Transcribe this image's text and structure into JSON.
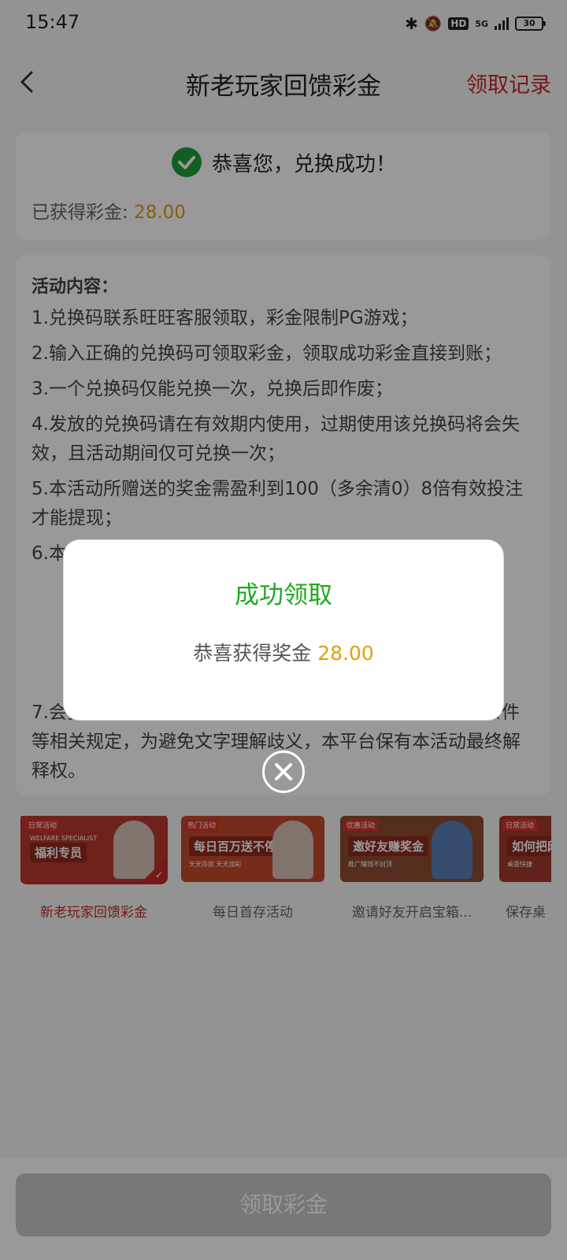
{
  "status_bar": {
    "time": "15:47",
    "hd": "HD",
    "net": "5G",
    "battery": "30"
  },
  "header": {
    "title": "新老玩家回馈彩金",
    "record": "领取记录"
  },
  "success": {
    "message": "恭喜您，兑换成功！",
    "earned_label": "已获得彩金: ",
    "earned_amount": "28.00"
  },
  "activity": {
    "title": "活动内容：",
    "items": [
      "1.兑换码联系旺旺客服领取，彩金限制PG游戏；",
      "2.输入正确的兑换码可领取彩金，领取成功彩金直接到账；",
      "3.一个兑换码仅能兑换一次，兑换后即作废；",
      "4.发放的兑换码请在有效期内使用，过期使用该兑换码将会失效，且活动期间仅可兑换一次；",
      "5.本活动所赠送的奖金需盈利到100（多余清0）8倍有效投注才能提现；",
      "6.本",
      "7.会员参与该活动时，本平台将默认会员同意且遵守对应条件等相关规定，为避免文字理解歧义，本平台保有本活动最终解释权。"
    ]
  },
  "banners": [
    {
      "tag": "日常活动",
      "headline": "福利专员",
      "sub": "WELFARE SPECIALIST",
      "label": "新老玩家回馈彩金",
      "bg": "#b83a2e"
    },
    {
      "tag": "热门活动",
      "headline": "每日百万送不停",
      "sub": "天天存款 天天加彩",
      "label": "每日首存活动",
      "bg": "#c54a2c"
    },
    {
      "tag": "优惠活动",
      "headline": "邀好友赚奖金",
      "sub": "推广赚钱不封顶",
      "label": "邀请好友开启宝箱...",
      "bg": "#8e4b2f"
    },
    {
      "tag": "日常活动",
      "headline": "如何把网",
      "sub": "桌面快捷",
      "label": "保存桌",
      "bg": "#a03a2b"
    }
  ],
  "bottom": {
    "claim_button": "领取彩金"
  },
  "modal": {
    "title": "成功领取",
    "message_prefix": "恭喜获得奖金 ",
    "amount": "28.00"
  },
  "colors": {
    "accent_red": "#c62828",
    "success_green": "#1faa1f",
    "amount_gold": "#e0a010"
  }
}
